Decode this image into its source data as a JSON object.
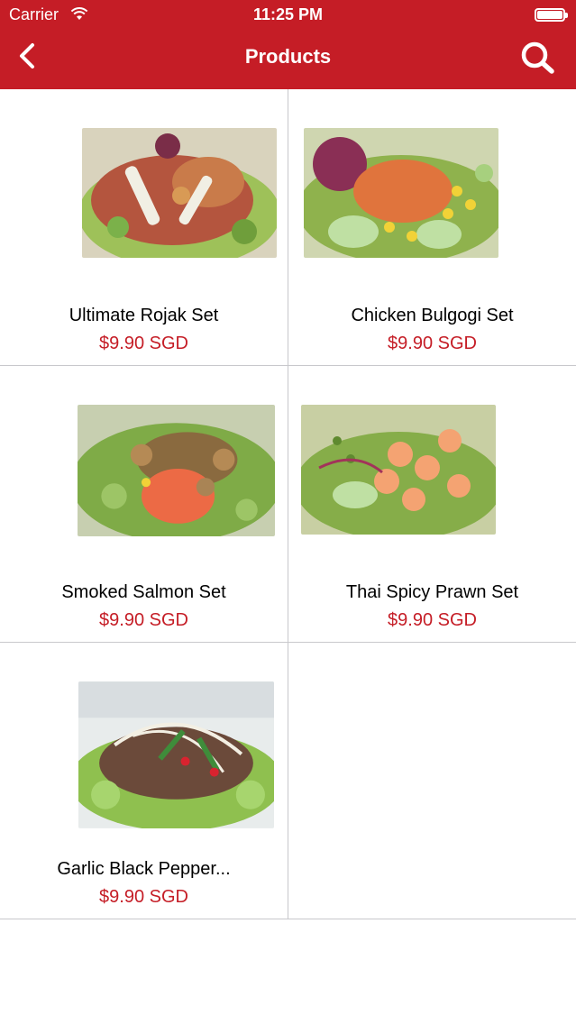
{
  "status_bar": {
    "carrier": "Carrier",
    "time": "11:25 PM"
  },
  "nav": {
    "title": "Products",
    "back_icon": "chevron-left-icon",
    "search_icon": "search-icon"
  },
  "colors": {
    "brand_red": "#c51d26",
    "price_red": "#c51d26",
    "divider": "#c8c8cc"
  },
  "products": [
    {
      "name": "Ultimate Rojak Set",
      "price": "$9.90 SGD"
    },
    {
      "name": "Chicken Bulgogi Set",
      "price": "$9.90 SGD"
    },
    {
      "name": "Smoked Salmon Set",
      "price": "$9.90 SGD"
    },
    {
      "name": "Thai Spicy Prawn Set",
      "price": "$9.90 SGD"
    },
    {
      "name": "Garlic Black Pepper...",
      "price": "$9.90 SGD"
    }
  ]
}
